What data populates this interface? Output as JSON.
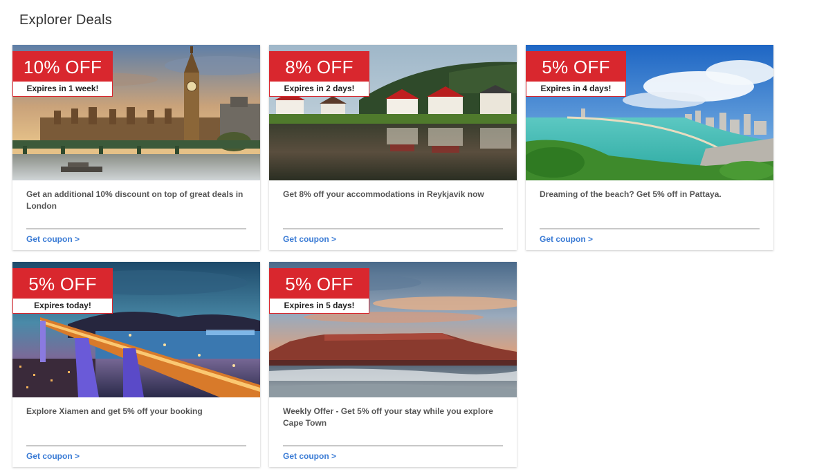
{
  "page": {
    "title": "Explorer Deals"
  },
  "deals": [
    {
      "discount": "10% OFF",
      "expiry": "Expires in 1 week!",
      "description": "Get an additional 10% discount on top of great deals in London",
      "cta": "Get coupon >",
      "image": "london-big-ben-photo"
    },
    {
      "discount": "8% OFF",
      "expiry": "Expires in 2 days!",
      "description": "Get 8% off your accommodations in Reykjavik now",
      "cta": "Get coupon >",
      "image": "reykjavik-lake-houses-photo"
    },
    {
      "discount": "5% OFF",
      "expiry": "Expires in 4 days!",
      "description": "Dreaming of the beach? Get 5% off in Pattaya.",
      "cta": "Get coupon >",
      "image": "pattaya-beach-bay-photo"
    },
    {
      "discount": "5% OFF",
      "expiry": "Expires today!",
      "description": "Explore Xiamen and get 5% off your booking",
      "cta": "Get coupon >",
      "image": "xiamen-bridge-night-photo"
    },
    {
      "discount": "5% OFF",
      "expiry": "Expires in 5 days!",
      "description": "Weekly Offer - Get 5% off your stay while you explore Cape Town",
      "cta": "Get coupon >",
      "image": "cape-town-table-mountain-photo"
    }
  ],
  "colors": {
    "badge_red": "#d9272e",
    "link_blue": "#3a7bd5",
    "divider_gray": "#c8c8c8"
  }
}
